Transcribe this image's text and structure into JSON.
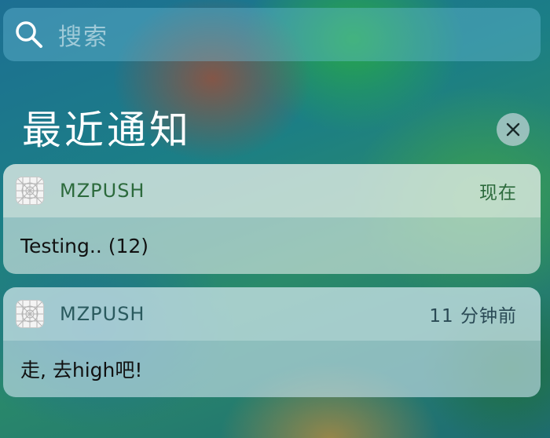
{
  "search": {
    "placeholder": "搜索",
    "icon": "search-icon"
  },
  "section": {
    "title": "最近通知",
    "clear_icon": "close-icon"
  },
  "notifications": [
    {
      "app_name": "MZPUSH",
      "time": "现在",
      "message": "Testing.. (12)",
      "icon": "app-placeholder-icon"
    },
    {
      "app_name": "MZPUSH",
      "time": "11 分钟前",
      "message": "走, 去high吧!",
      "icon": "app-placeholder-icon"
    }
  ]
}
